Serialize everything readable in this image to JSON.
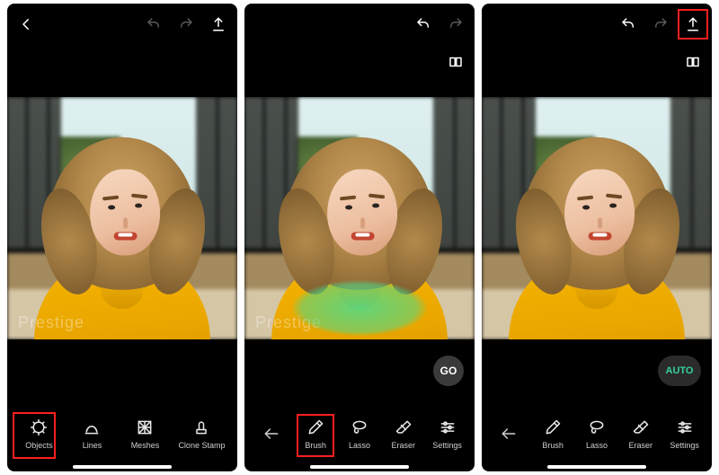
{
  "watermark": "Prestige",
  "action": {
    "go": "GO",
    "auto": "AUTO"
  },
  "tools_main": {
    "objects": "Objects",
    "lines": "Lines",
    "meshes": "Meshes",
    "clone_stamp": "Clone Stamp"
  },
  "tools_remove": {
    "brush": "Brush",
    "lasso": "Lasso",
    "eraser": "Eraser",
    "settings": "Settings"
  },
  "highlight": {
    "panel1_tool": "objects",
    "panel2_tool": "brush",
    "panel3_topright": "export"
  }
}
